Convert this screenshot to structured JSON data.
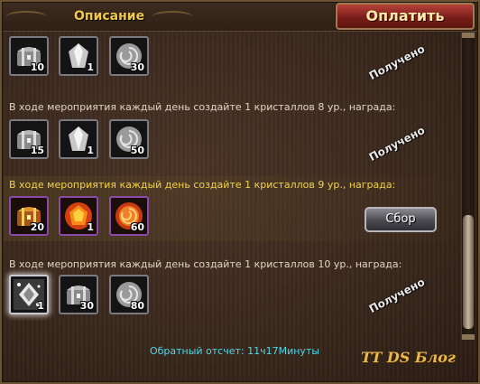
{
  "header": {
    "tab_title": "Описание",
    "pay_button": "Оплатить"
  },
  "colors": {
    "highlight_text": "#f2d24a",
    "countdown_text": "#4fd8e8",
    "pay_button": "#9a2a22",
    "rare_item_border": "#8a4aa8"
  },
  "rows": [
    {
      "text": "",
      "items": [
        {
          "icon": "silver-chest-icon",
          "qty": "10"
        },
        {
          "icon": "silver-crystal-icon",
          "qty": "1"
        },
        {
          "icon": "silver-orb-icon",
          "qty": "30"
        }
      ],
      "status": "Получено"
    },
    {
      "text": "В ходе мероприятия каждый день создайте 1 кристаллов 8 ур., награда:",
      "items": [
        {
          "icon": "silver-chest-icon",
          "qty": "15"
        },
        {
          "icon": "silver-crystal-icon",
          "qty": "1"
        },
        {
          "icon": "silver-orb-icon",
          "qty": "50"
        }
      ],
      "status": "Получено"
    },
    {
      "text": "В ходе мероприятия каждый день создайте 1 кристаллов 9 ур., награда:",
      "items": [
        {
          "icon": "gold-chest-icon",
          "qty": "20"
        },
        {
          "icon": "fire-gem-icon",
          "qty": "1"
        },
        {
          "icon": "fire-orb-icon",
          "qty": "60"
        }
      ],
      "action": "Сбор"
    },
    {
      "text": "В ходе мероприятия каждый день создайте 1 кристаллов 10 ур., награда:",
      "items": [
        {
          "icon": "sparkle-crystal-icon",
          "qty": "1"
        },
        {
          "icon": "silver-chest-icon",
          "qty": "30"
        },
        {
          "icon": "silver-orb-icon",
          "qty": "80"
        }
      ],
      "status": "Получено"
    }
  ],
  "footer": {
    "countdown": "Обратный отсчет: 11ч17Минуты",
    "watermark": "TT DS Блог"
  }
}
